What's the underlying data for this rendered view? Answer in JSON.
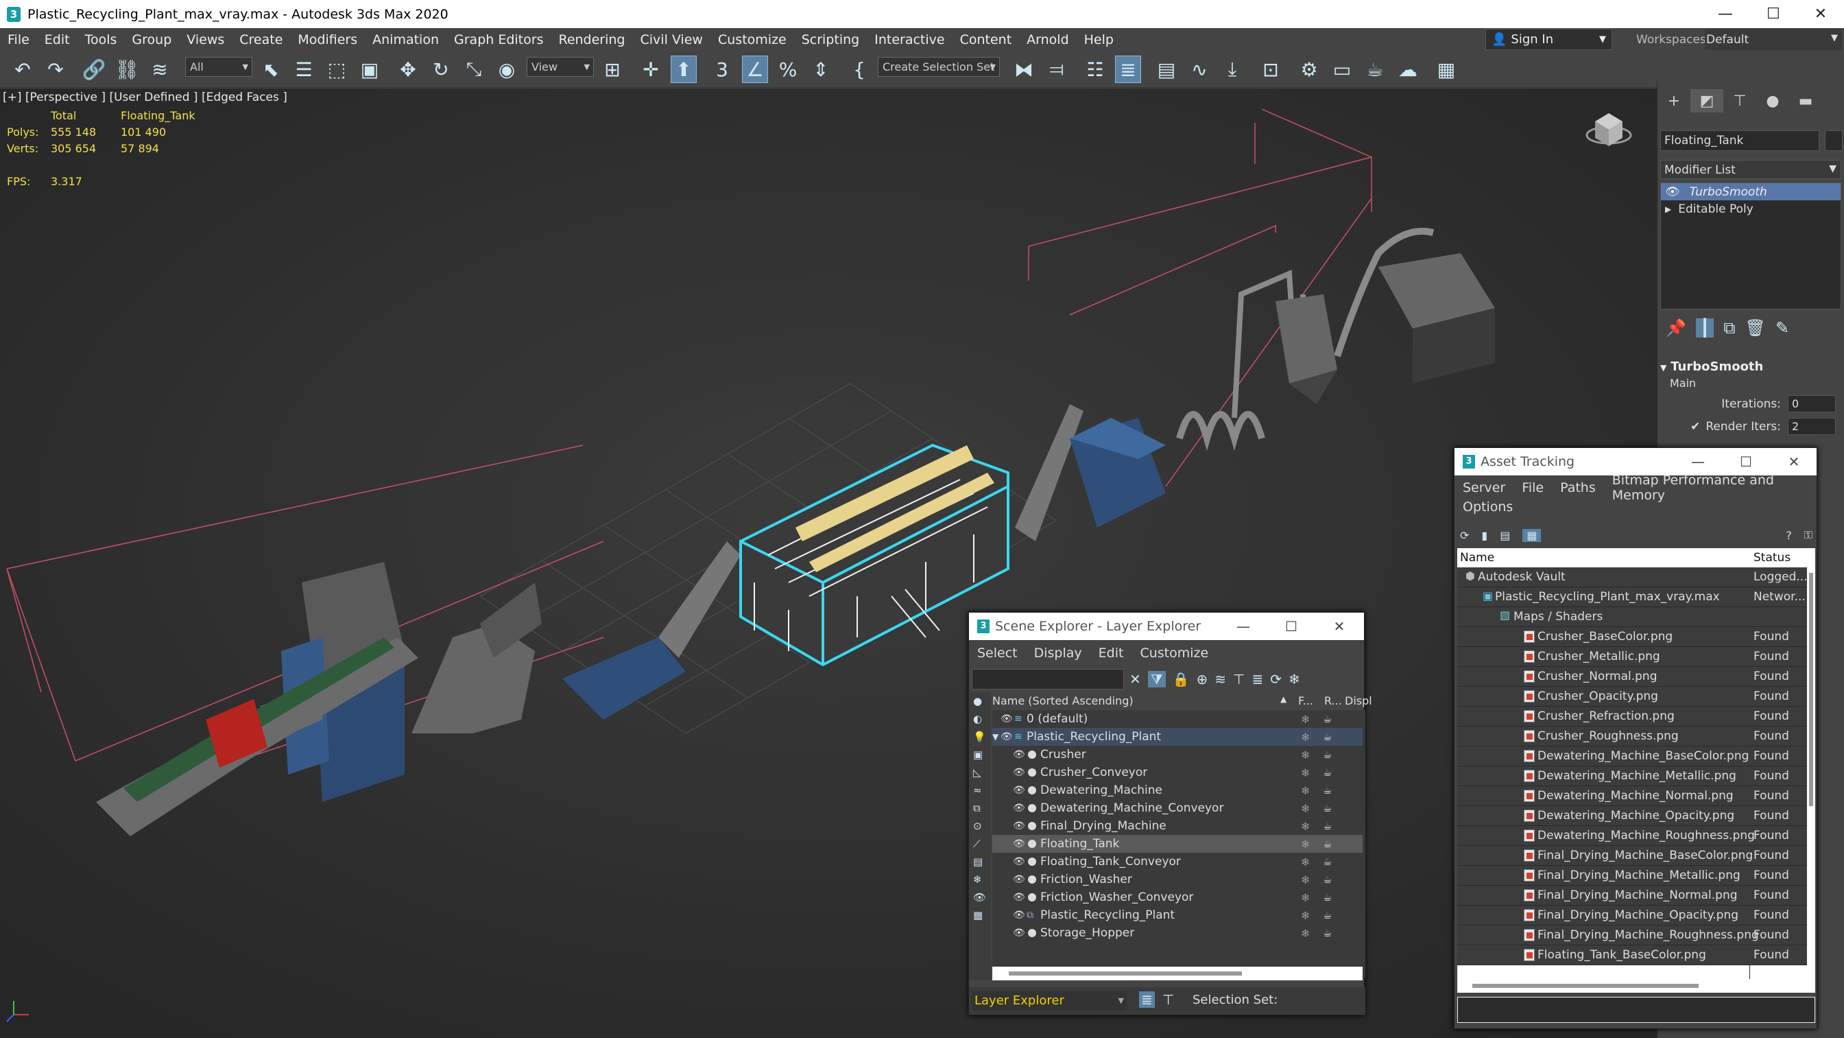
{
  "title": "Plastic_Recycling_Plant_max_vray.max - Autodesk 3ds Max 2020",
  "window_controls": {
    "minimize": "—",
    "maximize": "☐",
    "close": "✕"
  },
  "menu": [
    "File",
    "Edit",
    "Tools",
    "Group",
    "Views",
    "Create",
    "Modifiers",
    "Animation",
    "Graph Editors",
    "Rendering",
    "Civil View",
    "Customize",
    "Scripting",
    "Interactive",
    "Content",
    "Arnold",
    "Help"
  ],
  "account": {
    "signin": "Sign In",
    "workspaces_label": "Workspaces:",
    "workspace": "Default"
  },
  "toolbar": {
    "filter": "All",
    "view": "View",
    "selection_set": "Create Selection Set"
  },
  "viewport": {
    "label": "[+] [Perspective ] [User Defined ] [Edged Faces ]",
    "stats": {
      "total_label": "Total",
      "object_label": "Floating_Tank",
      "polys_label": "Polys:",
      "polys_total": "555 148",
      "polys_obj": "101 490",
      "verts_label": "Verts:",
      "verts_total": "305 654",
      "verts_obj": "57 894",
      "fps_label": "FPS:",
      "fps": "3.317"
    }
  },
  "command_panel": {
    "object_name": "Floating_Tank",
    "modifier_list": "Modifier List",
    "stack": [
      "TurboSmooth",
      "Editable Poly"
    ],
    "rollout_title": "TurboSmooth",
    "rollout_sub": "Main",
    "iterations_label": "Iterations:",
    "iterations": "0",
    "render_iters_label": "Render Iters:",
    "render_iters": "2"
  },
  "scene_explorer": {
    "title": "Scene Explorer - Layer Explorer",
    "menu": [
      "Select",
      "Display",
      "Edit",
      "Customize"
    ],
    "col_name": "Name (Sorted Ascending)",
    "col_frozen": "F...",
    "col_render": "R...",
    "col_display": "Displ",
    "rows": [
      {
        "name": "0 (default)",
        "level": 0,
        "layer": true
      },
      {
        "name": "Plastic_Recycling_Plant",
        "level": 0,
        "layer": true,
        "active": true
      },
      {
        "name": "Crusher",
        "level": 1
      },
      {
        "name": "Crusher_Conveyor",
        "level": 1
      },
      {
        "name": "Dewatering_Machine",
        "level": 1
      },
      {
        "name": "Dewatering_Machine_Conveyor",
        "level": 1
      },
      {
        "name": "Final_Drying_Machine",
        "level": 1
      },
      {
        "name": "Floating_Tank",
        "level": 1,
        "selected": true
      },
      {
        "name": "Floating_Tank_Conveyor",
        "level": 1
      },
      {
        "name": "Friction_Washer",
        "level": 1
      },
      {
        "name": "Friction_Washer_Conveyor",
        "level": 1
      },
      {
        "name": "Plastic_Recycling_Plant",
        "level": 1
      },
      {
        "name": "Storage_Hopper",
        "level": 1
      }
    ],
    "footer_mode": "Layer Explorer",
    "footer_selset": "Selection Set:"
  },
  "asset_tracking": {
    "title": "Asset Tracking",
    "menu": [
      "Server",
      "File",
      "Paths",
      "Bitmap Performance and Memory"
    ],
    "menu2": "Options",
    "col_name": "Name",
    "col_status": "Status",
    "rows": [
      {
        "name": "Autodesk Vault",
        "status": "Logged...",
        "level": 0,
        "kind": "vault"
      },
      {
        "name": "Plastic_Recycling_Plant_max_vray.max",
        "status": "Networ...",
        "level": 1,
        "kind": "max"
      },
      {
        "name": "Maps / Shaders",
        "status": "",
        "level": 2,
        "kind": "folder"
      },
      {
        "name": "Crusher_BaseColor.png",
        "status": "Found",
        "level": 3,
        "kind": "png"
      },
      {
        "name": "Crusher_Metallic.png",
        "status": "Found",
        "level": 3,
        "kind": "png"
      },
      {
        "name": "Crusher_Normal.png",
        "status": "Found",
        "level": 3,
        "kind": "png"
      },
      {
        "name": "Crusher_Opacity.png",
        "status": "Found",
        "level": 3,
        "kind": "png"
      },
      {
        "name": "Crusher_Refraction.png",
        "status": "Found",
        "level": 3,
        "kind": "png"
      },
      {
        "name": "Crusher_Roughness.png",
        "status": "Found",
        "level": 3,
        "kind": "png"
      },
      {
        "name": "Dewatering_Machine_BaseColor.png",
        "status": "Found",
        "level": 3,
        "kind": "png"
      },
      {
        "name": "Dewatering_Machine_Metallic.png",
        "status": "Found",
        "level": 3,
        "kind": "png"
      },
      {
        "name": "Dewatering_Machine_Normal.png",
        "status": "Found",
        "level": 3,
        "kind": "png"
      },
      {
        "name": "Dewatering_Machine_Opacity.png",
        "status": "Found",
        "level": 3,
        "kind": "png"
      },
      {
        "name": "Dewatering_Machine_Roughness.png",
        "status": "Found",
        "level": 3,
        "kind": "png"
      },
      {
        "name": "Final_Drying_Machine_BaseColor.png",
        "status": "Found",
        "level": 3,
        "kind": "png"
      },
      {
        "name": "Final_Drying_Machine_Metallic.png",
        "status": "Found",
        "level": 3,
        "kind": "png"
      },
      {
        "name": "Final_Drying_Machine_Normal.png",
        "status": "Found",
        "level": 3,
        "kind": "png"
      },
      {
        "name": "Final_Drying_Machine_Opacity.png",
        "status": "Found",
        "level": 3,
        "kind": "png"
      },
      {
        "name": "Final_Drying_Machine_Roughness.png",
        "status": "Found",
        "level": 3,
        "kind": "png"
      },
      {
        "name": "Floating_Tank_BaseColor.png",
        "status": "Found",
        "level": 3,
        "kind": "png"
      }
    ]
  },
  "colors": {
    "accent": "#5877a8",
    "selection_cyan": "#39d8f0",
    "stats_yellow": "#f0e24a",
    "bbox_pink": "#c9506b"
  }
}
